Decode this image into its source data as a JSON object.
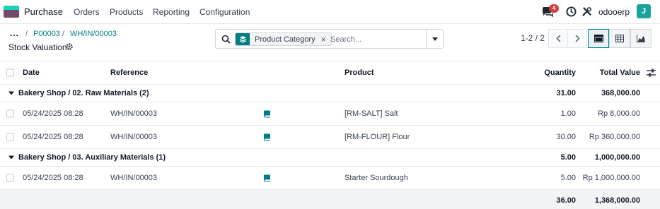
{
  "app": {
    "name": "Purchase",
    "icon": "purchase-app-icon"
  },
  "menu": [
    {
      "label": "Orders"
    },
    {
      "label": "Products"
    },
    {
      "label": "Reporting"
    },
    {
      "label": "Configuration"
    }
  ],
  "systray": {
    "chat_badge": "4",
    "db_name": "odooerp",
    "avatar_initial": "J"
  },
  "breadcrumb": {
    "dots": "...",
    "items": [
      "P00003",
      "WH/IN/00003"
    ],
    "separator": "/"
  },
  "page": {
    "title": "Stock Valuation"
  },
  "search": {
    "facet_label": "Product Category",
    "facet_remove": "×",
    "placeholder": "Search..."
  },
  "pager": {
    "value": "1-2 / 2"
  },
  "views": [
    "list",
    "pivot",
    "graph"
  ],
  "table": {
    "headers": {
      "date": "Date",
      "reference": "Reference",
      "product": "Product",
      "quantity": "Quantity",
      "total_value": "Total Value"
    },
    "groups": [
      {
        "label": "Bakery Shop / 02. Raw Materials (2)",
        "quantity": "31.00",
        "total": "368,000.00",
        "rows": [
          {
            "date": "05/24/2025 08:28",
            "reference": "WH/IN/00003",
            "product": "[RM-SALT] Salt",
            "quantity": "1.00",
            "value": "Rp 8,000.00"
          },
          {
            "date": "05/24/2025 08:28",
            "reference": "WH/IN/00003",
            "product": "[RM-FLOUR] Flour",
            "quantity": "30.00",
            "value": "Rp 360,000.00"
          }
        ]
      },
      {
        "label": "Bakery Shop / 03. Auxiliary Materials (1)",
        "quantity": "5.00",
        "total": "1,000,000.00",
        "rows": [
          {
            "date": "05/24/2025 08:28",
            "reference": "WH/IN/00003",
            "product": "Starter Sourdough",
            "quantity": "5.00",
            "value": "Rp 1,000,000.00"
          }
        ]
      }
    ],
    "footer": {
      "quantity": "36.00",
      "total": "1,368,000.00"
    }
  },
  "colors": {
    "accent": "#017e84",
    "badge": "#d23f3a",
    "avatar": "#1aa39a",
    "brand": "#714b67"
  }
}
